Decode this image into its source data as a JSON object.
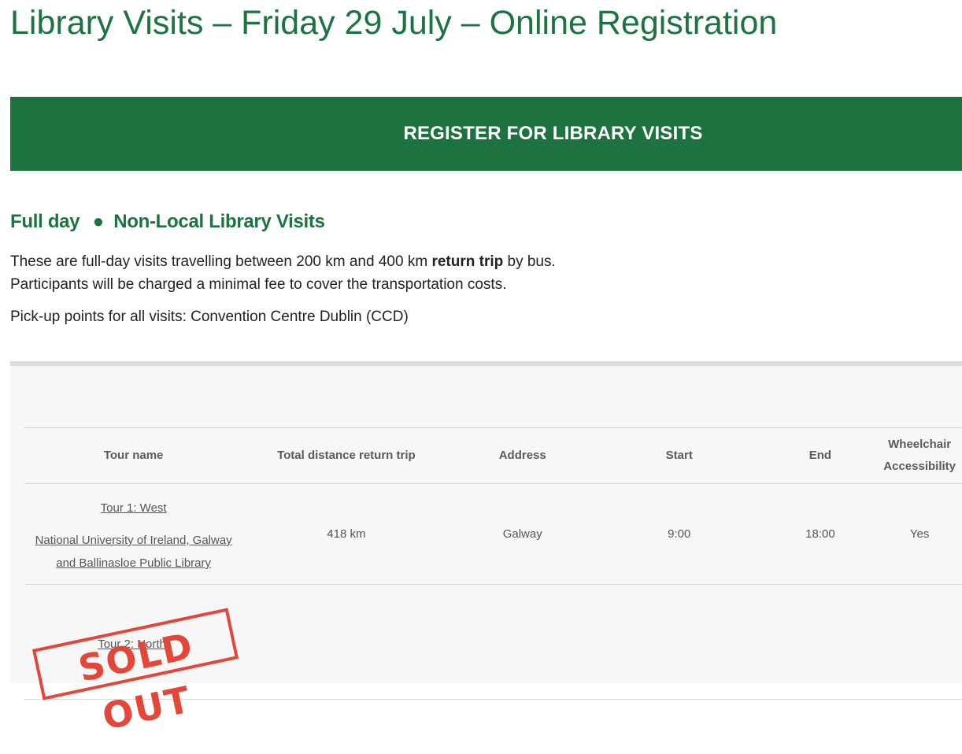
{
  "page": {
    "title": "Library Visits – Friday 29 July – Online Registration"
  },
  "register_button": {
    "label": "REGISTER FOR LIBRARY VISITS"
  },
  "section": {
    "heading_part1": "Full day",
    "heading_sep": "●",
    "heading_part2": "Non-Local Library Visits",
    "intro_before_bold": "These are full-day visits travelling between 200 km and 400 km ",
    "intro_bold": "return trip",
    "intro_after_bold": " by bus.",
    "intro_line2": "Participants will be charged a minimal fee to cover the transportation costs.",
    "pickup": "Pick-up points for all visits: Convention Centre Dublin (CCD)"
  },
  "table": {
    "headers": {
      "tour_name": "Tour name",
      "distance": "Total distance return trip",
      "address": "Address",
      "start": "Start",
      "end": "End",
      "wheelchair_line1": "Wheelchair",
      "wheelchair_line2": "Accessibility"
    },
    "rows": [
      {
        "tour_title": "Tour 1: West",
        "description_line1": "National University of Ireland, Galway",
        "description_line2": "and Ballinasloe Public Library",
        "distance": "418 km",
        "address": "Galway",
        "start": "9:00",
        "end": "18:00",
        "wheelchair": "Yes"
      },
      {
        "tour_title": "Tour 2: North:",
        "status_stamp": "SOLD OUT",
        "stamp_color": "#e2473a"
      }
    ]
  },
  "colors": {
    "brand_green": "#1d7340",
    "panel_bg": "#f7f7f7"
  }
}
